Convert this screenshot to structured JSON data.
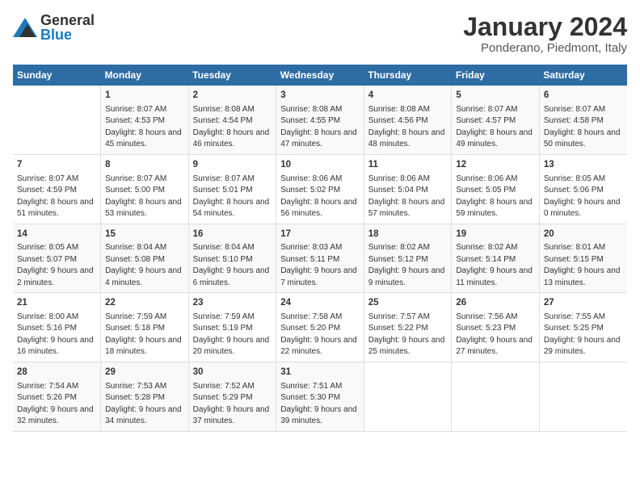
{
  "header": {
    "logo_general": "General",
    "logo_blue": "Blue",
    "month": "January 2024",
    "location": "Ponderano, Piedmont, Italy"
  },
  "weekdays": [
    "Sunday",
    "Monday",
    "Tuesday",
    "Wednesday",
    "Thursday",
    "Friday",
    "Saturday"
  ],
  "weeks": [
    [
      {
        "day": "",
        "sunrise": "",
        "sunset": "",
        "daylight": ""
      },
      {
        "day": "1",
        "sunrise": "Sunrise: 8:07 AM",
        "sunset": "Sunset: 4:53 PM",
        "daylight": "Daylight: 8 hours and 45 minutes."
      },
      {
        "day": "2",
        "sunrise": "Sunrise: 8:08 AM",
        "sunset": "Sunset: 4:54 PM",
        "daylight": "Daylight: 8 hours and 46 minutes."
      },
      {
        "day": "3",
        "sunrise": "Sunrise: 8:08 AM",
        "sunset": "Sunset: 4:55 PM",
        "daylight": "Daylight: 8 hours and 47 minutes."
      },
      {
        "day": "4",
        "sunrise": "Sunrise: 8:08 AM",
        "sunset": "Sunset: 4:56 PM",
        "daylight": "Daylight: 8 hours and 48 minutes."
      },
      {
        "day": "5",
        "sunrise": "Sunrise: 8:07 AM",
        "sunset": "Sunset: 4:57 PM",
        "daylight": "Daylight: 8 hours and 49 minutes."
      },
      {
        "day": "6",
        "sunrise": "Sunrise: 8:07 AM",
        "sunset": "Sunset: 4:58 PM",
        "daylight": "Daylight: 8 hours and 50 minutes."
      }
    ],
    [
      {
        "day": "7",
        "sunrise": "Sunrise: 8:07 AM",
        "sunset": "Sunset: 4:59 PM",
        "daylight": "Daylight: 8 hours and 51 minutes."
      },
      {
        "day": "8",
        "sunrise": "Sunrise: 8:07 AM",
        "sunset": "Sunset: 5:00 PM",
        "daylight": "Daylight: 8 hours and 53 minutes."
      },
      {
        "day": "9",
        "sunrise": "Sunrise: 8:07 AM",
        "sunset": "Sunset: 5:01 PM",
        "daylight": "Daylight: 8 hours and 54 minutes."
      },
      {
        "day": "10",
        "sunrise": "Sunrise: 8:06 AM",
        "sunset": "Sunset: 5:02 PM",
        "daylight": "Daylight: 8 hours and 56 minutes."
      },
      {
        "day": "11",
        "sunrise": "Sunrise: 8:06 AM",
        "sunset": "Sunset: 5:04 PM",
        "daylight": "Daylight: 8 hours and 57 minutes."
      },
      {
        "day": "12",
        "sunrise": "Sunrise: 8:06 AM",
        "sunset": "Sunset: 5:05 PM",
        "daylight": "Daylight: 8 hours and 59 minutes."
      },
      {
        "day": "13",
        "sunrise": "Sunrise: 8:05 AM",
        "sunset": "Sunset: 5:06 PM",
        "daylight": "Daylight: 9 hours and 0 minutes."
      }
    ],
    [
      {
        "day": "14",
        "sunrise": "Sunrise: 8:05 AM",
        "sunset": "Sunset: 5:07 PM",
        "daylight": "Daylight: 9 hours and 2 minutes."
      },
      {
        "day": "15",
        "sunrise": "Sunrise: 8:04 AM",
        "sunset": "Sunset: 5:08 PM",
        "daylight": "Daylight: 9 hours and 4 minutes."
      },
      {
        "day": "16",
        "sunrise": "Sunrise: 8:04 AM",
        "sunset": "Sunset: 5:10 PM",
        "daylight": "Daylight: 9 hours and 6 minutes."
      },
      {
        "day": "17",
        "sunrise": "Sunrise: 8:03 AM",
        "sunset": "Sunset: 5:11 PM",
        "daylight": "Daylight: 9 hours and 7 minutes."
      },
      {
        "day": "18",
        "sunrise": "Sunrise: 8:02 AM",
        "sunset": "Sunset: 5:12 PM",
        "daylight": "Daylight: 9 hours and 9 minutes."
      },
      {
        "day": "19",
        "sunrise": "Sunrise: 8:02 AM",
        "sunset": "Sunset: 5:14 PM",
        "daylight": "Daylight: 9 hours and 11 minutes."
      },
      {
        "day": "20",
        "sunrise": "Sunrise: 8:01 AM",
        "sunset": "Sunset: 5:15 PM",
        "daylight": "Daylight: 9 hours and 13 minutes."
      }
    ],
    [
      {
        "day": "21",
        "sunrise": "Sunrise: 8:00 AM",
        "sunset": "Sunset: 5:16 PM",
        "daylight": "Daylight: 9 hours and 16 minutes."
      },
      {
        "day": "22",
        "sunrise": "Sunrise: 7:59 AM",
        "sunset": "Sunset: 5:18 PM",
        "daylight": "Daylight: 9 hours and 18 minutes."
      },
      {
        "day": "23",
        "sunrise": "Sunrise: 7:59 AM",
        "sunset": "Sunset: 5:19 PM",
        "daylight": "Daylight: 9 hours and 20 minutes."
      },
      {
        "day": "24",
        "sunrise": "Sunrise: 7:58 AM",
        "sunset": "Sunset: 5:20 PM",
        "daylight": "Daylight: 9 hours and 22 minutes."
      },
      {
        "day": "25",
        "sunrise": "Sunrise: 7:57 AM",
        "sunset": "Sunset: 5:22 PM",
        "daylight": "Daylight: 9 hours and 25 minutes."
      },
      {
        "day": "26",
        "sunrise": "Sunrise: 7:56 AM",
        "sunset": "Sunset: 5:23 PM",
        "daylight": "Daylight: 9 hours and 27 minutes."
      },
      {
        "day": "27",
        "sunrise": "Sunrise: 7:55 AM",
        "sunset": "Sunset: 5:25 PM",
        "daylight": "Daylight: 9 hours and 29 minutes."
      }
    ],
    [
      {
        "day": "28",
        "sunrise": "Sunrise: 7:54 AM",
        "sunset": "Sunset: 5:26 PM",
        "daylight": "Daylight: 9 hours and 32 minutes."
      },
      {
        "day": "29",
        "sunrise": "Sunrise: 7:53 AM",
        "sunset": "Sunset: 5:28 PM",
        "daylight": "Daylight: 9 hours and 34 minutes."
      },
      {
        "day": "30",
        "sunrise": "Sunrise: 7:52 AM",
        "sunset": "Sunset: 5:29 PM",
        "daylight": "Daylight: 9 hours and 37 minutes."
      },
      {
        "day": "31",
        "sunrise": "Sunrise: 7:51 AM",
        "sunset": "Sunset: 5:30 PM",
        "daylight": "Daylight: 9 hours and 39 minutes."
      },
      {
        "day": "",
        "sunrise": "",
        "sunset": "",
        "daylight": ""
      },
      {
        "day": "",
        "sunrise": "",
        "sunset": "",
        "daylight": ""
      },
      {
        "day": "",
        "sunrise": "",
        "sunset": "",
        "daylight": ""
      }
    ]
  ]
}
